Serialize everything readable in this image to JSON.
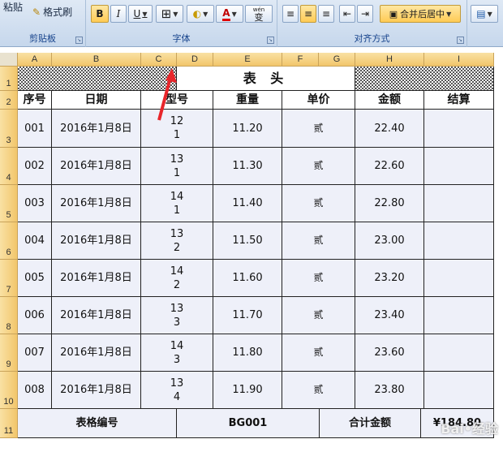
{
  "ribbon": {
    "paste_label": "粘贴",
    "format_painter_label": "格式刷",
    "clipboard_label": "剪贴板",
    "bold": "B",
    "italic": "I",
    "underline": "U",
    "font_label": "字体",
    "font_color_glyph": "A",
    "phonetic_glyph": "wén",
    "phonetic_char": "变",
    "alignment_label": "对齐方式",
    "merge_center_label": "合并后居中"
  },
  "columns": [
    "A",
    "B",
    "C",
    "D",
    "E",
    "F",
    "G",
    "H",
    "I"
  ],
  "rows": [
    "1",
    "2",
    "3",
    "4",
    "5",
    "6",
    "7",
    "8",
    "9",
    "10",
    "11"
  ],
  "table": {
    "title": "表 头",
    "headers": [
      "序号",
      "日期",
      "型号",
      "重量",
      "单价",
      "金额",
      "结算"
    ],
    "records": [
      {
        "seq": "001",
        "date": "2016年1月8日",
        "model1": "12",
        "model2": "1",
        "weight": "11.20",
        "price": "贰",
        "amount": "22.40",
        "settle": ""
      },
      {
        "seq": "002",
        "date": "2016年1月8日",
        "model1": "13",
        "model2": "1",
        "weight": "11.30",
        "price": "贰",
        "amount": "22.60",
        "settle": ""
      },
      {
        "seq": "003",
        "date": "2016年1月8日",
        "model1": "14",
        "model2": "1",
        "weight": "11.40",
        "price": "贰",
        "amount": "22.80",
        "settle": ""
      },
      {
        "seq": "004",
        "date": "2016年1月8日",
        "model1": "13",
        "model2": "2",
        "weight": "11.50",
        "price": "贰",
        "amount": "23.00",
        "settle": ""
      },
      {
        "seq": "005",
        "date": "2016年1月8日",
        "model1": "14",
        "model2": "2",
        "weight": "11.60",
        "price": "贰",
        "amount": "23.20",
        "settle": ""
      },
      {
        "seq": "006",
        "date": "2016年1月8日",
        "model1": "13",
        "model2": "3",
        "weight": "11.70",
        "price": "贰",
        "amount": "23.40",
        "settle": ""
      },
      {
        "seq": "007",
        "date": "2016年1月8日",
        "model1": "14",
        "model2": "3",
        "weight": "11.80",
        "price": "贰",
        "amount": "23.60",
        "settle": ""
      },
      {
        "seq": "008",
        "date": "2016年1月8日",
        "model1": "13",
        "model2": "4",
        "weight": "11.90",
        "price": "贰",
        "amount": "23.80",
        "settle": ""
      }
    ],
    "footer": {
      "code_label": "表格编号",
      "code_value": "BG001",
      "total_label": "合计金额",
      "total_value": "¥184.80"
    }
  },
  "colors": {
    "cell_fill": "#eef0f9",
    "header_fill": "#f2c66b",
    "arrow": "#e8262b"
  }
}
